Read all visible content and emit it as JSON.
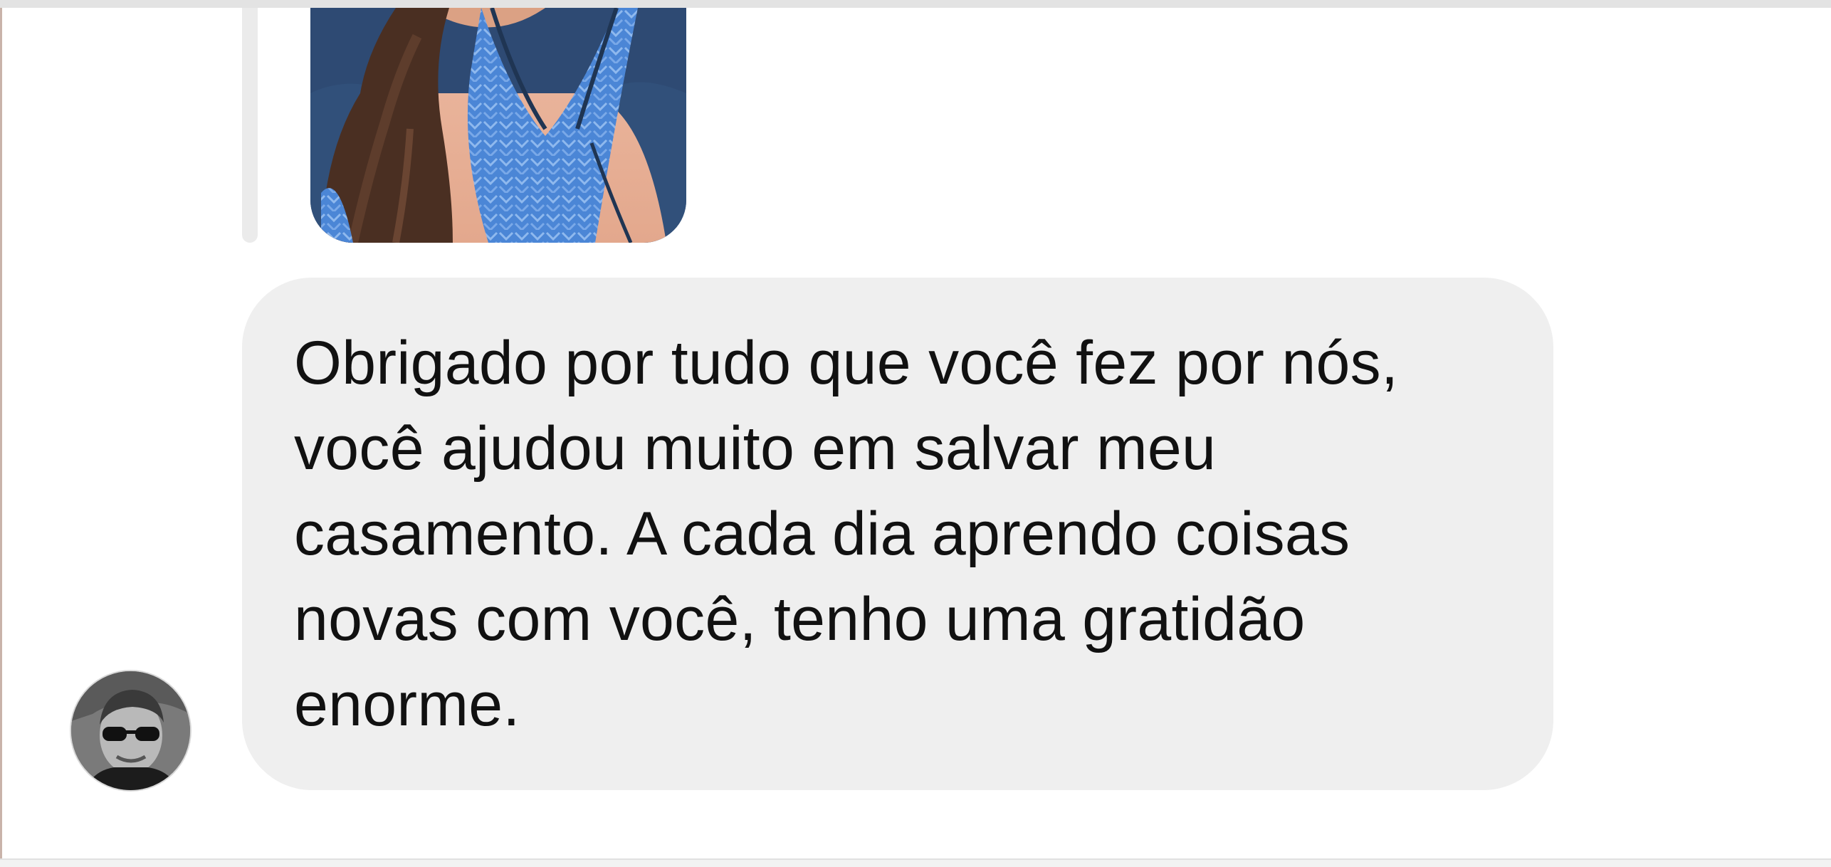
{
  "conversation": {
    "replied_story": {
      "image": "story-photo",
      "description_icon": "woman-in-blue-top-photo"
    },
    "message": {
      "text": "Obrigado por tudo que você fez por nós, você ajudou muito em salvar meu casamento. A cada dia aprendo coisas novas com você, tenho uma gratidão enorme.",
      "bubble_color": "#efefef",
      "text_color": "#111111"
    },
    "sender": {
      "avatar": "profile-avatar"
    }
  }
}
